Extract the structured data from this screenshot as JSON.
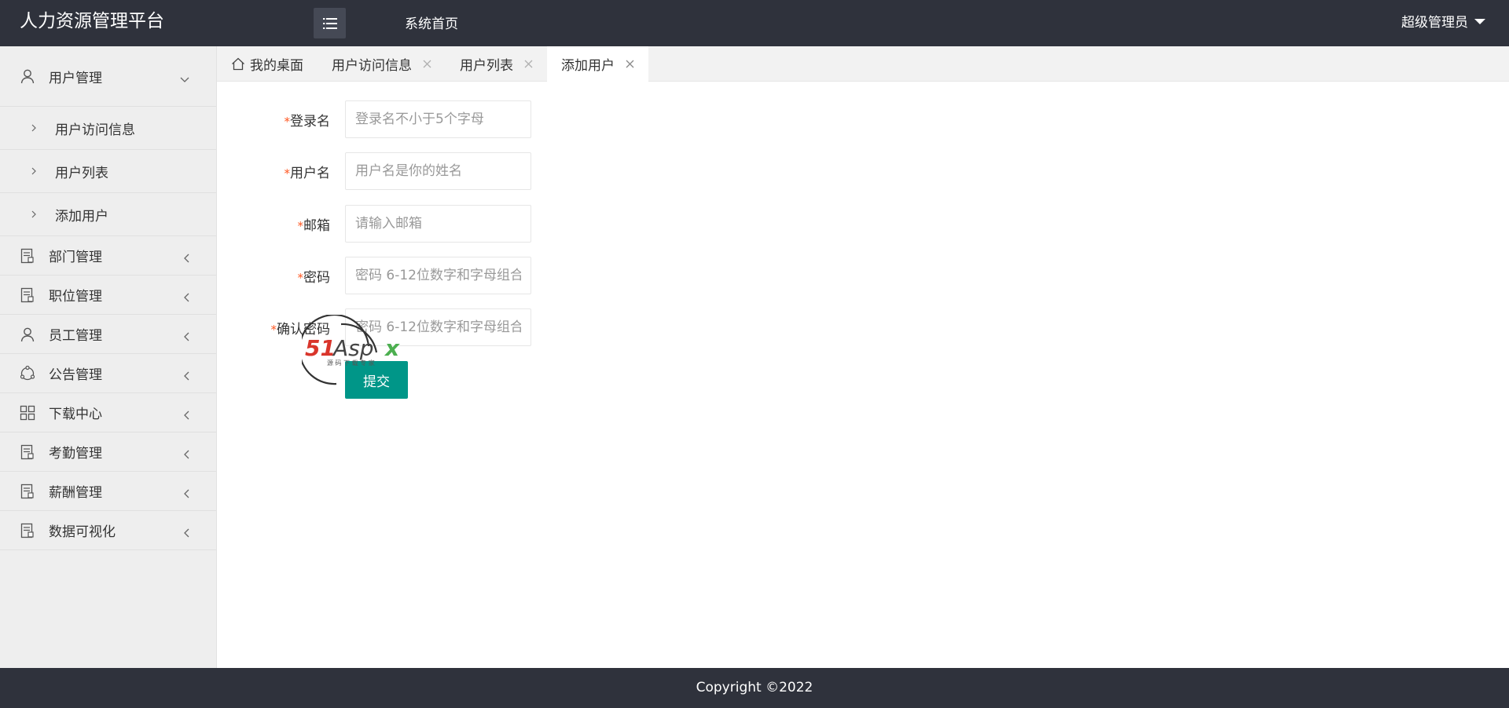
{
  "header": {
    "app_title": "人力资源管理平台",
    "home_link": "系统首页",
    "user_name": "超级管理员"
  },
  "sidebar": {
    "items": [
      {
        "label": "用户管理",
        "icon": "user-icon",
        "expanded": true,
        "children": [
          {
            "label": "用户访问信息"
          },
          {
            "label": "用户列表"
          },
          {
            "label": "添加用户"
          }
        ]
      },
      {
        "label": "部门管理",
        "icon": "document-icon"
      },
      {
        "label": "职位管理",
        "icon": "document-icon"
      },
      {
        "label": "员工管理",
        "icon": "user-icon"
      },
      {
        "label": "公告管理",
        "icon": "cycle-icon"
      },
      {
        "label": "下载中心",
        "icon": "grid-icon"
      },
      {
        "label": "考勤管理",
        "icon": "document-icon"
      },
      {
        "label": "薪酬管理",
        "icon": "document-icon"
      },
      {
        "label": "数据可视化",
        "icon": "document-icon"
      }
    ]
  },
  "tabs": [
    {
      "label": "我的桌面",
      "closable": false,
      "active": false
    },
    {
      "label": "用户访问信息",
      "closable": true,
      "active": false
    },
    {
      "label": "用户列表",
      "closable": true,
      "active": false
    },
    {
      "label": "添加用户",
      "closable": true,
      "active": true
    }
  ],
  "form": {
    "required_mark": "*",
    "fields": [
      {
        "label": "登录名",
        "placeholder": "登录名不小于5个字母",
        "value": ""
      },
      {
        "label": "用户名",
        "placeholder": "用户名是你的姓名",
        "value": ""
      },
      {
        "label": "邮箱",
        "placeholder": "请输入邮箱",
        "value": ""
      },
      {
        "label": "密码",
        "placeholder": "密码 6-12位数字和字母组合",
        "value": ""
      },
      {
        "label": "确认密码",
        "placeholder": "密码 6-12位数字和字母组合",
        "value": ""
      }
    ],
    "submit_label": "提交"
  },
  "watermark": {
    "text": "51Aspx",
    "subtext": "源码下载专家"
  },
  "footer": {
    "copyright": "Copyright ©2022"
  },
  "colors": {
    "header_bg": "#2f323c",
    "sidebar_bg": "#eeeeee",
    "primary": "#009688",
    "required": "#ff5722"
  }
}
